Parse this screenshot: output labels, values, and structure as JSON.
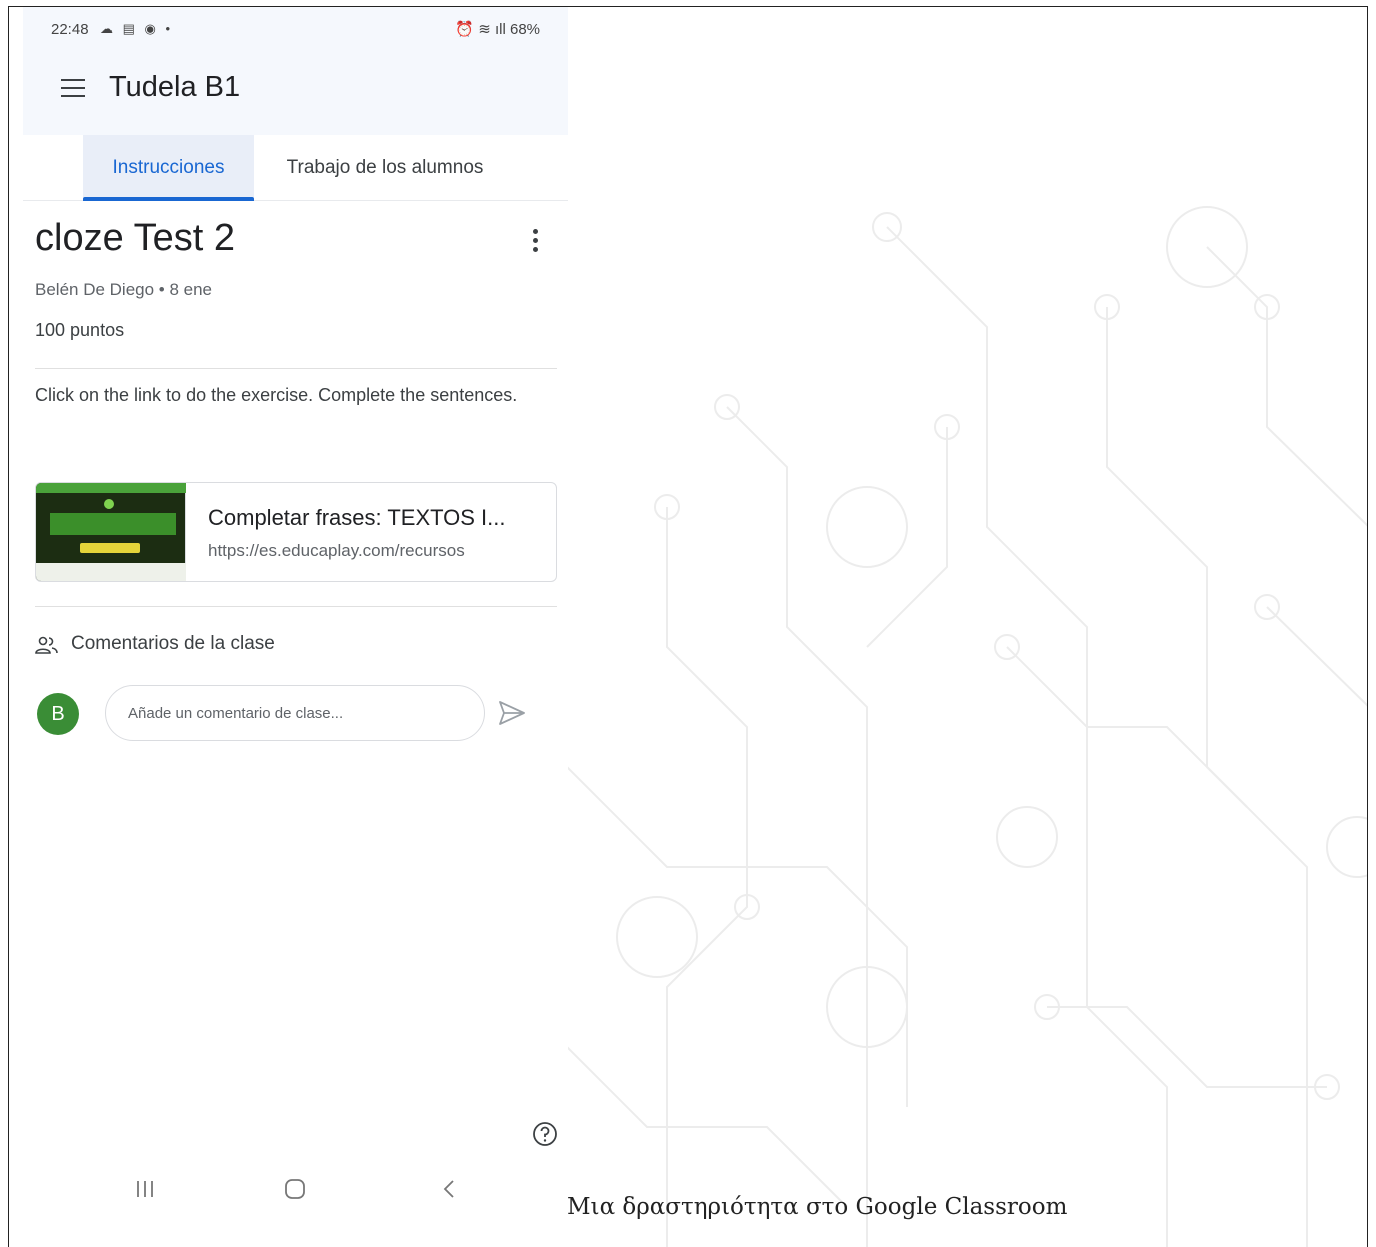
{
  "status_bar": {
    "time": "22:48",
    "left_icons": "☁ ▤ ◉ •",
    "right_text": "⏰ ≋ ıll 68%"
  },
  "app": {
    "title": "Tudela B1"
  },
  "tabs": [
    {
      "label": "Instrucciones",
      "active": true
    },
    {
      "label": "Trabajo de los alumnos",
      "active": false
    }
  ],
  "assignment": {
    "title": "cloze Test 2",
    "meta": "Belén De Diego • 8 ene",
    "points": "100 puntos",
    "description": "Click on the link to do the exercise. Complete the sentences."
  },
  "attachment": {
    "title": "Completar frases: TEXTOS I...",
    "url": "https://es.educaplay.com/recursos"
  },
  "comments": {
    "heading": "Comentarios de la clase",
    "avatar_letter": "B",
    "placeholder": "Añade un comentario de clase..."
  },
  "caption": "Μια δραστηριότητα στο Google Classroom",
  "colors": {
    "accent": "#1967d2",
    "avatar": "#3a8d36",
    "appbar_bg": "#f5f8fd"
  },
  "icons": [
    "menu-icon",
    "more-vert-icon",
    "people-icon",
    "send-icon",
    "help-icon",
    "recent-apps-icon",
    "home-icon",
    "back-icon"
  ]
}
